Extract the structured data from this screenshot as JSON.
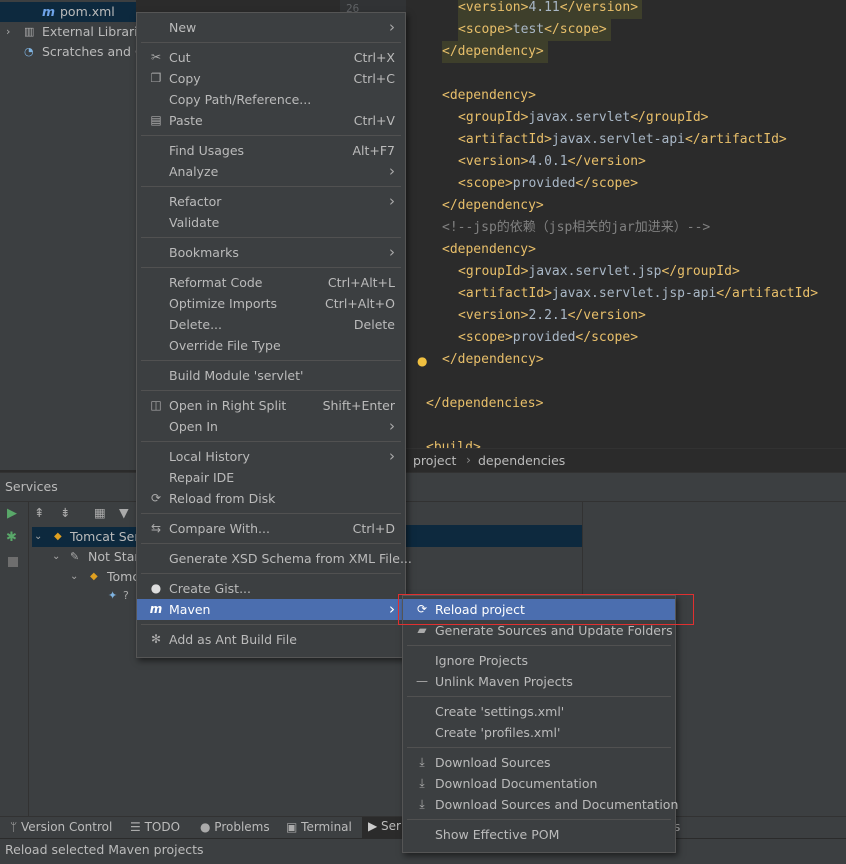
{
  "project_tree": {
    "items": [
      {
        "label": "pom.xml",
        "icon": "maven-m-icon"
      },
      {
        "label": "External Librari",
        "icon": "library-icon"
      },
      {
        "label": "Scratches and C",
        "icon": "scratches-icon"
      }
    ],
    "line_number": "26"
  },
  "editor": {
    "lines": [
      {
        "indent": "    ",
        "open": "<version>",
        "text": "4.11",
        "close": "</version>"
      },
      {
        "indent": "    ",
        "open": "<scope>",
        "text": "test",
        "close": "</scope>"
      },
      {
        "indent": "  ",
        "open": "</dependency>",
        "text": "",
        "close": ""
      },
      {
        "indent": "",
        "open": "",
        "text": "",
        "close": ""
      },
      {
        "indent": "  ",
        "open": "<dependency>",
        "text": "",
        "close": ""
      },
      {
        "indent": "    ",
        "open": "<groupId>",
        "text": "javax.servlet",
        "close": "</groupId>"
      },
      {
        "indent": "    ",
        "open": "<artifactId>",
        "text": "javax.servlet-api",
        "close": "</artifactId>"
      },
      {
        "indent": "    ",
        "open": "<version>",
        "text": "4.0.1",
        "close": "</version>"
      },
      {
        "indent": "    ",
        "open": "<scope>",
        "text": "provided",
        "close": "</scope>"
      },
      {
        "indent": "  ",
        "open": "</dependency>",
        "text": "",
        "close": ""
      },
      {
        "indent": "  ",
        "comment": "<!--jsp的依赖（jsp相关的jar加进来）-->"
      },
      {
        "indent": "  ",
        "open": "<dependency>",
        "text": "",
        "close": ""
      },
      {
        "indent": "    ",
        "open": "<groupId>",
        "text": "javax.servlet.jsp",
        "close": "</groupId>"
      },
      {
        "indent": "    ",
        "open": "<artifactId>",
        "text": "javax.servlet.jsp-api",
        "close": "</artifactId>"
      },
      {
        "indent": "    ",
        "open": "<version>",
        "text": "2.2.1",
        "close": "</version>"
      },
      {
        "indent": "    ",
        "open": "<scope>",
        "text": "provided",
        "close": "</scope>"
      },
      {
        "indent": "  ",
        "open": "</dependency>",
        "text": "",
        "close": ""
      },
      {
        "indent": "",
        "open": "",
        "text": "",
        "close": ""
      },
      {
        "indent": "",
        "open": "</dependencies>",
        "text": "",
        "close": ""
      },
      {
        "indent": "",
        "open": "",
        "text": "",
        "close": ""
      },
      {
        "indent": "",
        "open": "<build>",
        "text": "",
        "close": ""
      }
    ]
  },
  "breadcrumb": {
    "items": [
      "project",
      "dependencies"
    ]
  },
  "services": {
    "title": "Services",
    "tree": [
      {
        "label": "Tomcat Ser"
      },
      {
        "label": "Not Star"
      },
      {
        "label": "Tomc"
      }
    ]
  },
  "bottom_tabs": [
    "Version Control",
    "TODO",
    "Problems",
    "Terminal",
    "Ser",
    "s"
  ],
  "status": {
    "text": "Reload selected Maven projects"
  },
  "context_menu": {
    "items": [
      {
        "label": "New",
        "shortcut": "",
        "submenu": true,
        "icon": ""
      },
      {
        "separator": true
      },
      {
        "label": "Cut",
        "shortcut": "Ctrl+X",
        "icon": "scissors-icon"
      },
      {
        "label": "Copy",
        "shortcut": "Ctrl+C",
        "icon": "copy-icon"
      },
      {
        "label": "Copy Path/Reference...",
        "shortcut": ""
      },
      {
        "label": "Paste",
        "shortcut": "Ctrl+V",
        "icon": "paste-icon"
      },
      {
        "separator": true
      },
      {
        "label": "Find Usages",
        "shortcut": "Alt+F7"
      },
      {
        "label": "Analyze",
        "shortcut": "",
        "submenu": true
      },
      {
        "separator": true
      },
      {
        "label": "Refactor",
        "shortcut": "",
        "submenu": true
      },
      {
        "label": "Validate",
        "shortcut": ""
      },
      {
        "separator": true
      },
      {
        "label": "Bookmarks",
        "shortcut": "",
        "submenu": true
      },
      {
        "separator": true
      },
      {
        "label": "Reformat Code",
        "shortcut": "Ctrl+Alt+L"
      },
      {
        "label": "Optimize Imports",
        "shortcut": "Ctrl+Alt+O"
      },
      {
        "label": "Delete...",
        "shortcut": "Delete"
      },
      {
        "label": "Override File Type",
        "shortcut": ""
      },
      {
        "separator": true
      },
      {
        "label": "Build Module 'servlet'",
        "shortcut": ""
      },
      {
        "separator": true
      },
      {
        "label": "Open in Right Split",
        "shortcut": "Shift+Enter",
        "icon": "split-icon"
      },
      {
        "label": "Open In",
        "shortcut": "",
        "submenu": true
      },
      {
        "separator": true
      },
      {
        "label": "Local History",
        "shortcut": "",
        "submenu": true
      },
      {
        "label": "Repair IDE",
        "shortcut": ""
      },
      {
        "label": "Reload from Disk",
        "shortcut": "",
        "icon": "reload-icon"
      },
      {
        "separator": true
      },
      {
        "label": "Compare With...",
        "shortcut": "Ctrl+D",
        "icon": "compare-icon"
      },
      {
        "separator": true
      },
      {
        "label": "Generate XSD Schema from XML File...",
        "shortcut": ""
      },
      {
        "separator": true
      },
      {
        "label": "Create Gist...",
        "shortcut": "",
        "icon": "github-icon"
      },
      {
        "label": "Maven",
        "shortcut": "",
        "submenu": true,
        "icon": "maven-m-icon",
        "active": true
      },
      {
        "separator": true
      },
      {
        "label": "Add as Ant Build File",
        "shortcut": "",
        "icon": "ant-icon"
      }
    ]
  },
  "maven_submenu": {
    "items": [
      {
        "label": "Reload project",
        "icon": "reload-icon",
        "active": true
      },
      {
        "label": "Generate Sources and Update Folders",
        "icon": "generate-sources-icon"
      },
      {
        "separator": true
      },
      {
        "label": "Ignore Projects",
        "icon": ""
      },
      {
        "label": "Unlink Maven Projects",
        "icon": "minus-icon"
      },
      {
        "separator": true
      },
      {
        "label": "Create 'settings.xml'",
        "icon": ""
      },
      {
        "label": "Create 'profiles.xml'",
        "icon": ""
      },
      {
        "separator": true
      },
      {
        "label": "Download Sources",
        "icon": "download-icon"
      },
      {
        "label": "Download Documentation",
        "icon": "download-icon"
      },
      {
        "label": "Download Sources and Documentation",
        "icon": "download-icon"
      },
      {
        "separator": true
      },
      {
        "label": "Show Effective POM",
        "icon": ""
      }
    ]
  },
  "colors": {
    "accent": "#4b6eaf",
    "highlight_box": "#e03030",
    "tag": "#e8bf6a",
    "text": "#a9b7c6"
  }
}
